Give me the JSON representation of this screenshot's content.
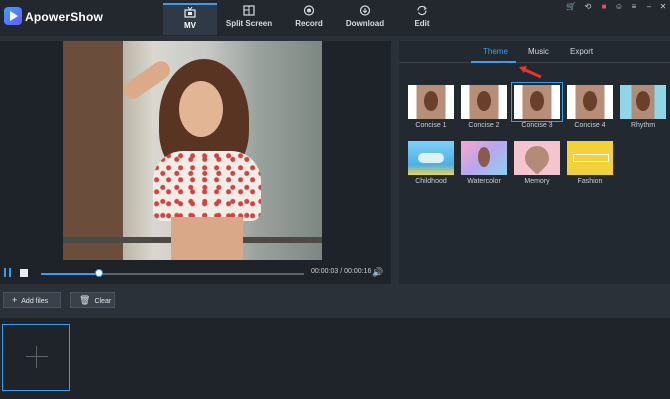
{
  "app": {
    "title": "ApowerShow"
  },
  "nav": [
    {
      "label": "MV",
      "icon": "tv-icon",
      "active": true
    },
    {
      "label": "Split Screen",
      "icon": "split-screen-icon"
    },
    {
      "label": "Record",
      "icon": "record-icon"
    },
    {
      "label": "Download",
      "icon": "download-icon"
    },
    {
      "label": "Edit",
      "icon": "refresh-icon"
    }
  ],
  "window_controls": [
    "cart-icon",
    "pin-icon",
    "gift-icon",
    "user-icon",
    "menu-icon",
    "minimize-icon",
    "close-icon"
  ],
  "player": {
    "timecode": "00:00:03 / 00:00:16",
    "progress_fraction": 0.22,
    "state": "playing"
  },
  "panel": {
    "tabs": [
      {
        "label": "Theme",
        "active": true
      },
      {
        "label": "Music"
      },
      {
        "label": "Export"
      }
    ],
    "themes": [
      {
        "label": "Concise 1"
      },
      {
        "label": "Concise 2"
      },
      {
        "label": "Concise 3",
        "selected": true
      },
      {
        "label": "Concise 4"
      },
      {
        "label": "Rhythm"
      },
      {
        "label": "Childhood"
      },
      {
        "label": "Watercolor"
      },
      {
        "label": "Memory"
      },
      {
        "label": "Fashion"
      }
    ]
  },
  "toolbar": {
    "add_files": "Add files",
    "clear": "Clear"
  },
  "colors": {
    "accent": "#3c9cf0",
    "background": "#2b3138",
    "panel": "#232930",
    "annotation_arrow": "#e8342a"
  }
}
